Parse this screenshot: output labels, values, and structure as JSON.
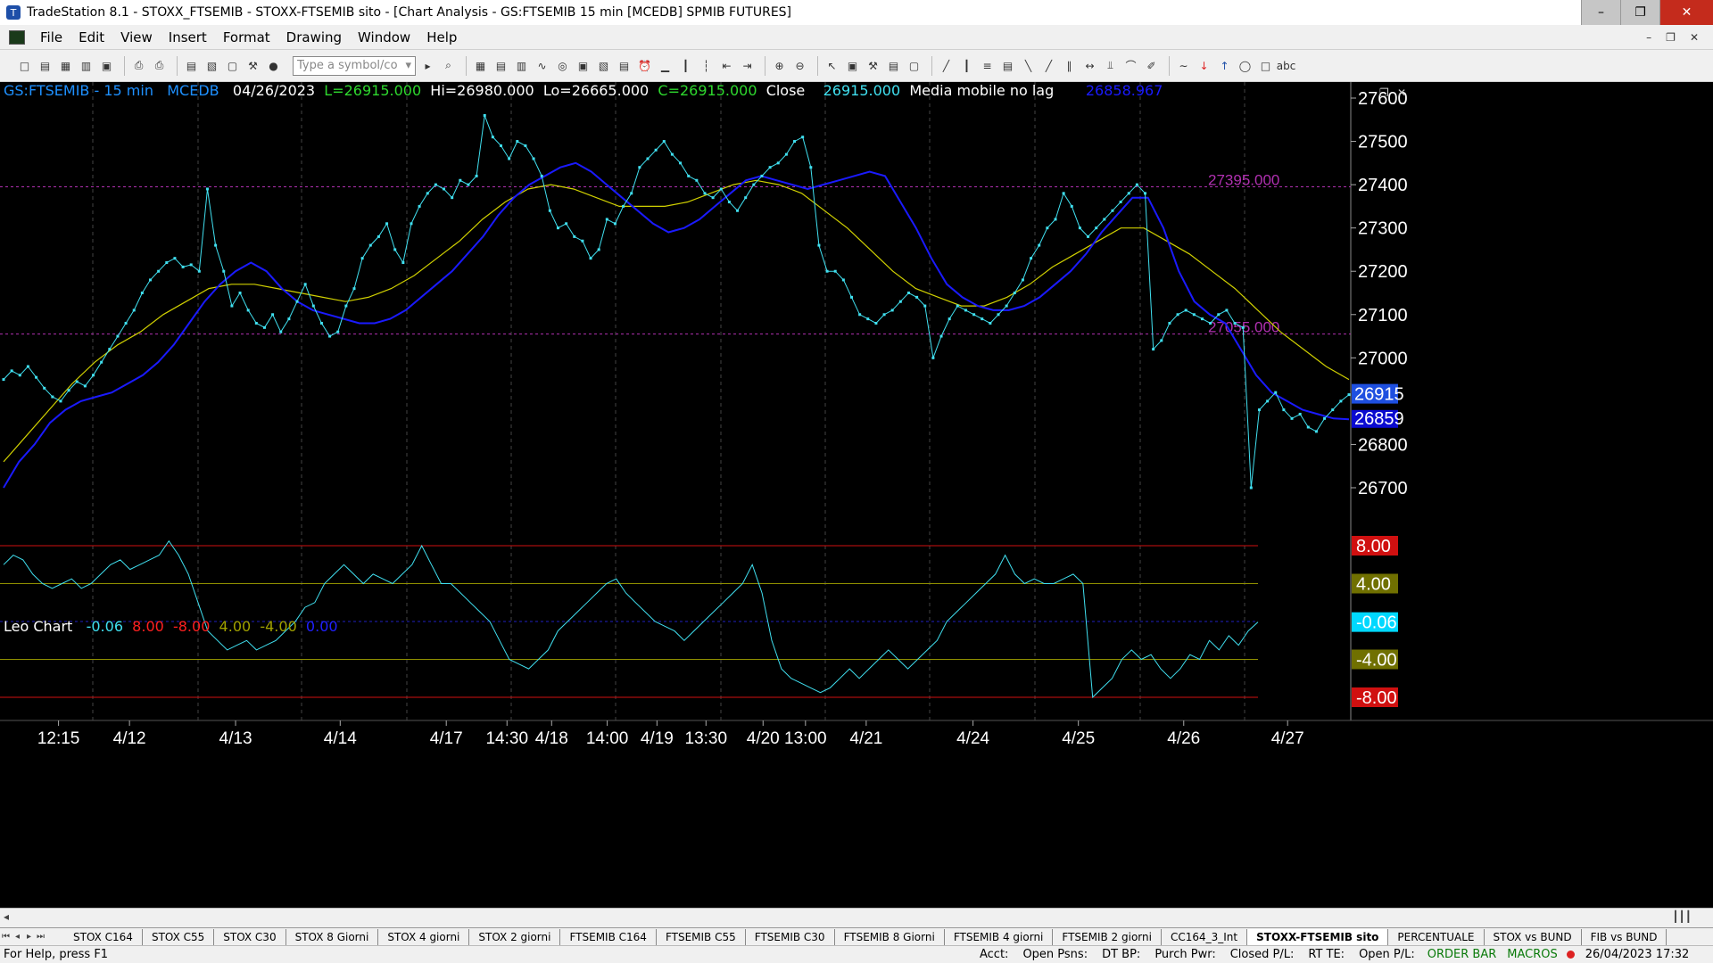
{
  "titlebar": {
    "title": "TradeStation 8.1 - STOXX_FTSEMIB - STOXX-FTSEMIB sito - [Chart Analysis - GS:FTSEMIB  15 min  [MCEDB] SPMIB FUTURES]"
  },
  "menubar": {
    "items": [
      "File",
      "Edit",
      "View",
      "Insert",
      "Format",
      "Drawing",
      "Window",
      "Help"
    ]
  },
  "toolbar": {
    "symbol_placeholder": "Type a symbol/co"
  },
  "price_header": {
    "symbol": "GS:FTSEMIB - 15 min",
    "data_source": "MCEDB",
    "date": "04/26/2023",
    "low_last": "L=26915.000",
    "high": "Hi=26980.000",
    "low": "Lo=26665.000",
    "close_eq": "C=26915.000",
    "close_label": "Close",
    "close_value": "26915.000",
    "indicator_name": "Media mobile no lag",
    "indicator_value": "26858.967"
  },
  "osc_header": {
    "name": "Leo Chart",
    "values": [
      "-0.06",
      "8.00",
      "-8.00",
      "4.00",
      "-4.00",
      "0.00"
    ]
  },
  "price_levels": {
    "upper_label": "27395.000",
    "lower_label": "27055.000"
  },
  "price_axis": {
    "ticks": [
      "27600",
      "27500",
      "27400",
      "27300",
      "27200",
      "27100",
      "27000",
      "26800",
      "26700"
    ],
    "last_price_tag": "26915",
    "ma_tag": "26859"
  },
  "osc_axis": {
    "tags": [
      "8.00",
      "4.00",
      "-0.06",
      "-4.00",
      "-8.00"
    ]
  },
  "time_axis": {
    "labels": [
      "12:15",
      "4/12",
      "4/13",
      "4/14",
      "4/17",
      "14:30",
      "4/18",
      "14:00",
      "4/19",
      "13:30",
      "4/20",
      "13:00",
      "4/21",
      "4/24",
      "4/25",
      "4/26",
      "4/27"
    ]
  },
  "chart_data": {
    "type": "line",
    "title": "GS:FTSEMIB - 15 min",
    "price_ylim": [
      26650,
      27660
    ],
    "series": [
      {
        "name": "Close",
        "color": "#40e0f0",
        "values": [
          26950,
          26970,
          26960,
          26980,
          26955,
          26930,
          26910,
          26900,
          26925,
          26945,
          26935,
          26960,
          26990,
          27020,
          27050,
          27080,
          27110,
          27150,
          27180,
          27200,
          27220,
          27230,
          27210,
          27215,
          27200,
          27390,
          27260,
          27200,
          27120,
          27150,
          27110,
          27080,
          27070,
          27100,
          27060,
          27090,
          27130,
          27170,
          27120,
          27080,
          27050,
          27060,
          27120,
          27160,
          27230,
          27260,
          27280,
          27310,
          27250,
          27220,
          27310,
          27350,
          27380,
          27400,
          27390,
          27370,
          27410,
          27400,
          27420,
          27560,
          27510,
          27490,
          27460,
          27500,
          27490,
          27460,
          27420,
          27340,
          27300,
          27310,
          27280,
          27270,
          27230,
          27250,
          27320,
          27310,
          27350,
          27380,
          27440,
          27460,
          27480,
          27500,
          27470,
          27450,
          27420,
          27410,
          27380,
          27370,
          27390,
          27360,
          27340,
          27370,
          27400,
          27420,
          27440,
          27450,
          27470,
          27500,
          27510,
          27440,
          27260,
          27200,
          27200,
          27180,
          27140,
          27100,
          27090,
          27080,
          27100,
          27110,
          27130,
          27150,
          27140,
          27120,
          27000,
          27050,
          27090,
          27120,
          27110,
          27100,
          27090,
          27080,
          27100,
          27120,
          27150,
          27180,
          27230,
          27260,
          27300,
          27320,
          27380,
          27350,
          27300,
          27280,
          27300,
          27320,
          27340,
          27360,
          27380,
          27400,
          27380,
          27020,
          27040,
          27080,
          27100,
          27110,
          27100,
          27090,
          27080,
          27100,
          27110,
          27080,
          27070,
          26700,
          26880,
          26900,
          26920,
          26880,
          26860,
          26870,
          26840,
          26830,
          26860,
          26880,
          26900,
          26915
        ]
      },
      {
        "name": "Media mobile no lag",
        "color": "#1a1aff",
        "values": [
          26700,
          26760,
          26800,
          26850,
          26880,
          26900,
          26910,
          26920,
          26940,
          26960,
          26990,
          27030,
          27080,
          27130,
          27170,
          27200,
          27220,
          27200,
          27160,
          27130,
          27110,
          27100,
          27090,
          27080,
          27080,
          27090,
          27110,
          27140,
          27170,
          27200,
          27240,
          27280,
          27330,
          27370,
          27400,
          27420,
          27440,
          27450,
          27430,
          27400,
          27370,
          27340,
          27310,
          27290,
          27300,
          27320,
          27350,
          27380,
          27410,
          27420,
          27410,
          27400,
          27390,
          27400,
          27410,
          27420,
          27430,
          27420,
          27360,
          27300,
          27230,
          27170,
          27140,
          27120,
          27110,
          27110,
          27120,
          27140,
          27170,
          27200,
          27240,
          27290,
          27330,
          27370,
          27370,
          27300,
          27200,
          27130,
          27100,
          27080,
          27020,
          26960,
          26920,
          26900,
          26880,
          26870,
          26860,
          26858
        ]
      },
      {
        "name": "Average",
        "color": "#d0d000",
        "values": [
          26760,
          26820,
          26880,
          26940,
          26990,
          27030,
          27060,
          27100,
          27130,
          27160,
          27170,
          27170,
          27160,
          27150,
          27140,
          27130,
          27140,
          27160,
          27190,
          27230,
          27270,
          27320,
          27360,
          27390,
          27400,
          27390,
          27370,
          27350,
          27350,
          27350,
          27360,
          27380,
          27400,
          27410,
          27400,
          27380,
          27340,
          27300,
          27250,
          27200,
          27160,
          27140,
          27120,
          27120,
          27140,
          27170,
          27210,
          27240,
          27270,
          27300,
          27300,
          27270,
          27240,
          27200,
          27160,
          27110,
          27060,
          27020,
          26980,
          26950
        ]
      }
    ],
    "oscillator": {
      "name": "Leo Chart",
      "ylim": [
        -10,
        10
      ],
      "levels": [
        8,
        4,
        0,
        -4,
        -8
      ],
      "values": [
        6,
        7,
        6.5,
        5,
        4,
        3.5,
        4,
        4.5,
        3.5,
        4,
        5,
        6,
        6.5,
        5.5,
        6,
        6.5,
        7,
        8.5,
        7,
        5,
        2,
        -1,
        -2,
        -3,
        -2.5,
        -2,
        -3,
        -2.5,
        -2,
        -1,
        0,
        1.5,
        2,
        4,
        5,
        6,
        5,
        4,
        5,
        4.5,
        4,
        5,
        6,
        8,
        6,
        4,
        4,
        3,
        2,
        1,
        0,
        -2,
        -4,
        -4.5,
        -5,
        -4,
        -3,
        -1,
        0,
        1,
        2,
        3,
        4,
        4.5,
        3,
        2,
        1,
        0,
        -0.5,
        -1,
        -2,
        -1,
        0,
        1,
        2,
        3,
        4,
        6,
        3,
        -2,
        -5,
        -6,
        -6.5,
        -7,
        -7.5,
        -7,
        -6,
        -5,
        -6,
        -5,
        -4,
        -3,
        -4,
        -5,
        -4,
        -3,
        -2,
        0,
        1,
        2,
        3,
        4,
        5,
        7,
        5,
        4,
        4.5,
        4,
        4,
        4.5,
        5,
        4,
        -8,
        -7,
        -6,
        -4,
        -3,
        -4,
        -3.5,
        -5,
        -6,
        -5,
        -3.5,
        -4,
        -2,
        -3,
        -1.5,
        -2.5,
        -1,
        -0.06
      ]
    }
  },
  "tabs": [
    "STOX C164",
    "STOX C55",
    "STOX  C30",
    "STOX  8 Giorni",
    "STOX 4 giorni",
    "STOX  2 giorni",
    "FTSEMIB C164",
    "FTSEMIB C55",
    "FTSEMIB C30",
    "FTSEMIB  8 Giorni",
    "FTSEMIB  4 giorni",
    "FTSEMIB  2 giorni",
    "CC164_3_Int",
    "STOXX-FTSEMIB sito",
    "PERCENTUALE",
    "STOX vs BUND",
    "FIB vs BUND"
  ],
  "active_tab": "STOXX-FTSEMIB sito",
  "statusbar": {
    "help": "For Help, press F1",
    "acct": "Acct:",
    "open_psns": "Open Psns:",
    "dt_bp": "DT BP:",
    "purch_pwr": "Purch Pwr:",
    "closed_pl": "Closed P/L:",
    "rt_te": "RT TE:",
    "open_pl": "Open P/L:",
    "order_bar": "ORDER BAR",
    "macros": "MACROS",
    "datetime": "26/04/2023 17:32"
  }
}
